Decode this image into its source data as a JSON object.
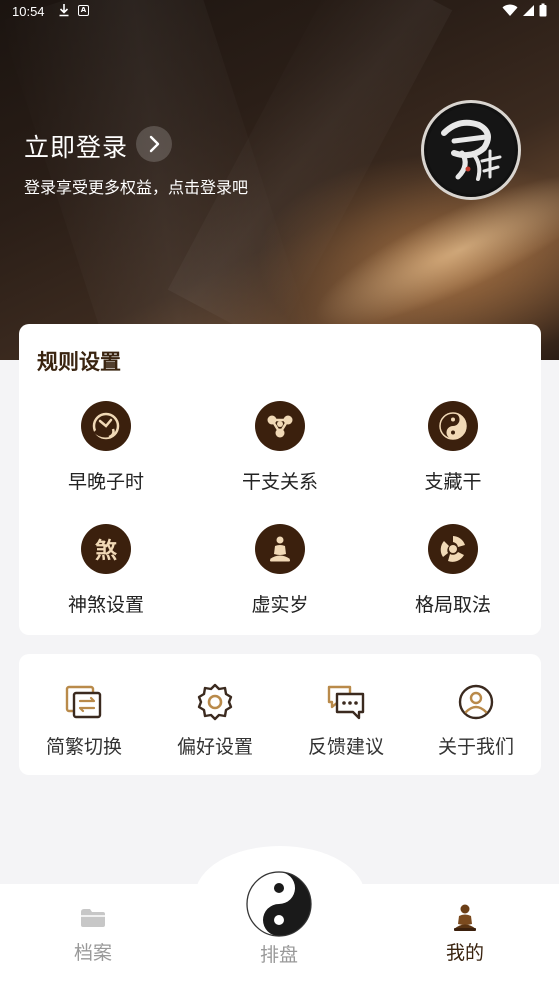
{
  "status_bar": {
    "time": "10:54"
  },
  "header": {
    "login_title": "立即登录",
    "login_subtitle": "登录享受更多权益，点击登录吧"
  },
  "rules_card": {
    "title": "规则设置",
    "items": [
      {
        "label": "早晚子时",
        "icon": "clock-swirl-icon"
      },
      {
        "label": "干支关系",
        "icon": "node-network-icon"
      },
      {
        "label": "支藏干",
        "icon": "yinyang-icon"
      },
      {
        "label": "神煞设置",
        "icon": "sha-character-icon"
      },
      {
        "label": "虚实岁",
        "icon": "meditation-figure-icon"
      },
      {
        "label": "格局取法",
        "icon": "triskele-swirl-icon"
      }
    ],
    "sha_glyph": "煞"
  },
  "tools_card": {
    "items": [
      {
        "label": "简繁切换",
        "icon": "switch-document-icon"
      },
      {
        "label": "偏好设置",
        "icon": "gear-icon"
      },
      {
        "label": "反馈建议",
        "icon": "chat-bubbles-icon"
      },
      {
        "label": "关于我们",
        "icon": "user-circle-icon"
      }
    ]
  },
  "bottom_nav": {
    "items": [
      {
        "label": "档案",
        "icon": "folder-icon",
        "active": false
      },
      {
        "label": "排盘",
        "icon": "taiji-icon",
        "active": false
      },
      {
        "label": "我的",
        "icon": "buddha-figure-icon",
        "active": true
      }
    ]
  },
  "colors": {
    "accent_dark": "#3b200d",
    "accent_gold": "#b98a4a",
    "inactive_text": "#999999"
  }
}
